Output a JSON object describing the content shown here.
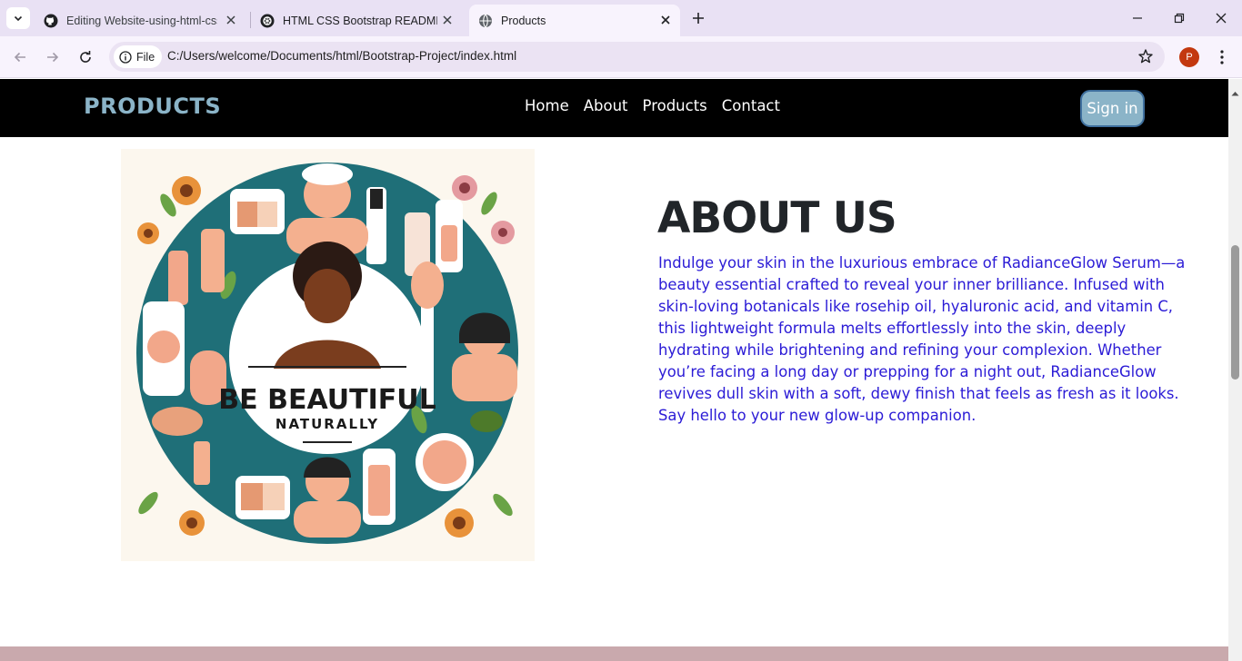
{
  "browser": {
    "tabs": [
      {
        "title": "Editing Website-using-html-css",
        "icon": "github-icon",
        "active": false
      },
      {
        "title": "HTML CSS Bootstrap README",
        "icon": "chatgpt-icon",
        "active": false
      },
      {
        "title": "Products",
        "icon": "globe-icon",
        "active": true
      }
    ],
    "omnibox": {
      "chip_label": "File",
      "url": "C:/Users/welcome/Documents/html/Bootstrap-Project/index.html"
    },
    "profile_initial": "P"
  },
  "site": {
    "brand": "PRODUCTS",
    "nav": {
      "home": "Home",
      "about": "About",
      "products": "Products",
      "contact": "Contact"
    },
    "signin_label": "Sign in",
    "about": {
      "heading": "ABOUT US",
      "body": "Indulge your skin in the luxurious embrace of RadianceGlow Serum—a beauty essential crafted to reveal your inner brilliance. Infused with skin-loving botanicals like rosehip oil, hyaluronic acid, and vitamin C, this lightweight formula melts effortlessly into the skin, deeply hydrating while brightening and refining your complexion. Whether you’re facing a long day or prepping for a night out, RadianceGlow revives dull skin with a soft, dewy finish that feels as fresh as it looks. Say hello to your new glow-up companion."
    },
    "hero_image": {
      "title_line": "BE BEAUTIFUL",
      "subtitle_line": "NATURALLY"
    }
  },
  "colors": {
    "brand": "#8bb4c8",
    "about_text": "#2b1bd6",
    "nav_bg": "#000000",
    "footer_strip": "#c9a9ad"
  }
}
